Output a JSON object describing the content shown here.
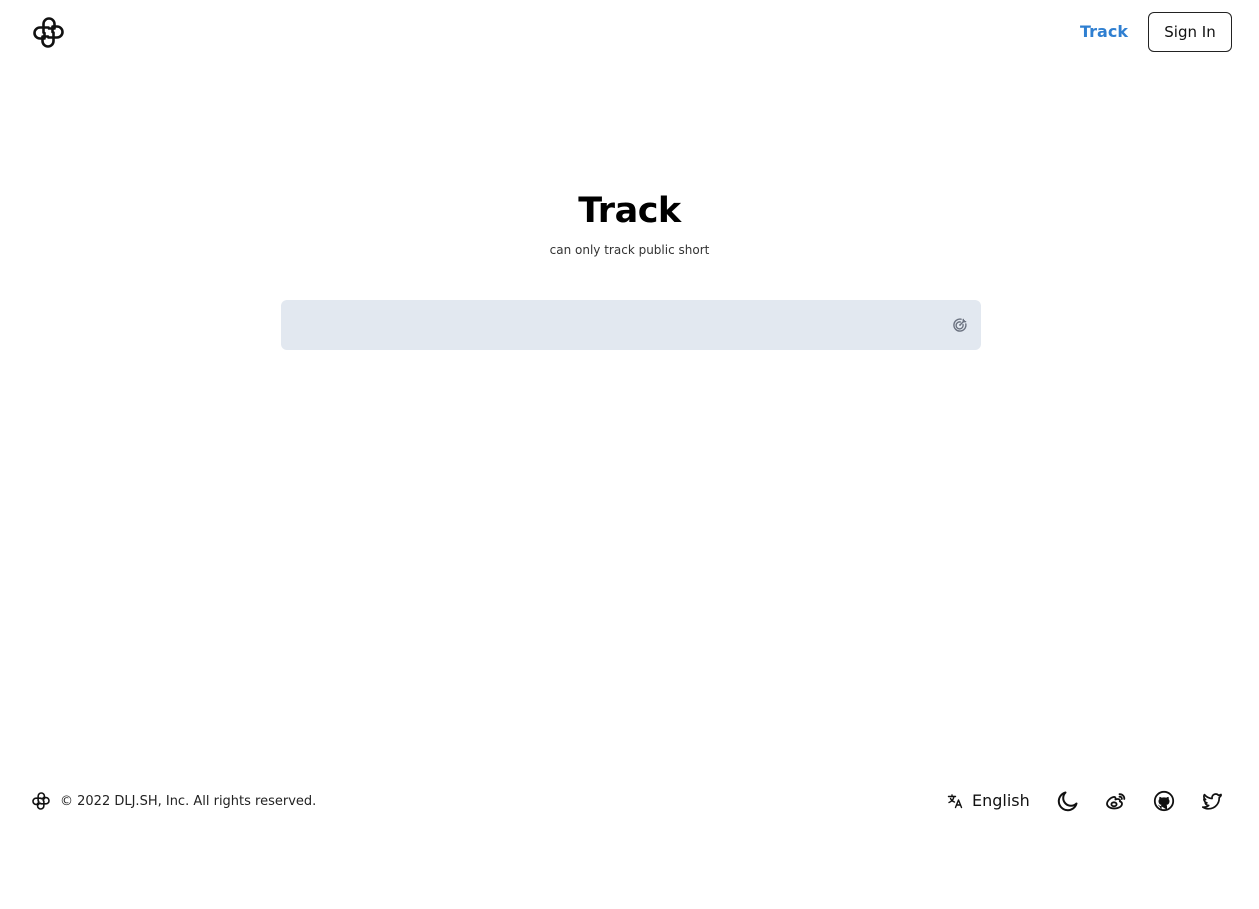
{
  "header": {
    "logo_icon": "dljsh-logo-icon",
    "nav_track_label": "Track",
    "signin_label": "Sign In"
  },
  "main": {
    "title": "Track",
    "subtitle": "can only track public short",
    "search": {
      "value": "",
      "placeholder": "",
      "submit_icon": "track-target-icon"
    }
  },
  "footer": {
    "copyright": "© 2022 DLJ.SH, Inc. All rights reserved.",
    "language": {
      "icon": "translate-icon",
      "label": "English"
    },
    "icons": [
      "moon-icon",
      "weibo-icon",
      "github-icon",
      "twitter-icon"
    ]
  },
  "colors": {
    "accent": "#2f7fd1",
    "input_background": "#e2e8f0",
    "text": "#000000",
    "background": "#ffffff"
  }
}
